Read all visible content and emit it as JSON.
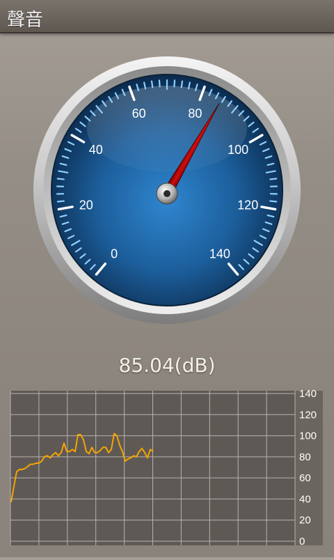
{
  "app": {
    "title": "聲音"
  },
  "gauge": {
    "min": 0,
    "max": 140,
    "major_labels": [
      "0",
      "20",
      "40",
      "60",
      "80",
      "100",
      "120",
      "140"
    ],
    "value": 85.04
  },
  "reading": {
    "text": "85.04(dB)"
  },
  "chart_data": {
    "type": "line",
    "title": "",
    "xlabel": "",
    "ylabel": "",
    "ylim": [
      0,
      140
    ],
    "yticks": [
      0,
      20,
      40,
      60,
      80,
      100,
      120,
      140
    ],
    "grid": true,
    "series": [
      {
        "color": "#f5a500",
        "x": [
          0,
          1,
          2,
          3,
          4,
          5,
          6,
          7,
          8,
          9,
          10,
          11,
          12,
          13,
          14,
          15,
          16,
          17,
          18,
          19,
          20,
          21,
          22,
          23,
          24,
          25,
          26,
          27,
          28,
          29,
          30,
          31,
          32,
          33,
          34,
          35,
          36,
          37,
          38,
          39,
          40,
          41,
          42,
          43,
          44,
          45,
          46,
          47,
          48,
          49,
          50,
          51
        ],
        "values": [
          37,
          52,
          66,
          68,
          68,
          69,
          71,
          73,
          73,
          74,
          74,
          76,
          80,
          81,
          79,
          82,
          84,
          81,
          84,
          93,
          85,
          85,
          87,
          85,
          101,
          101,
          96,
          85,
          83,
          89,
          84,
          84,
          86,
          89,
          89,
          84,
          87,
          102,
          100,
          91,
          85,
          76,
          78,
          79,
          81,
          80,
          85,
          88,
          84,
          79,
          87,
          85
        ]
      }
    ]
  }
}
